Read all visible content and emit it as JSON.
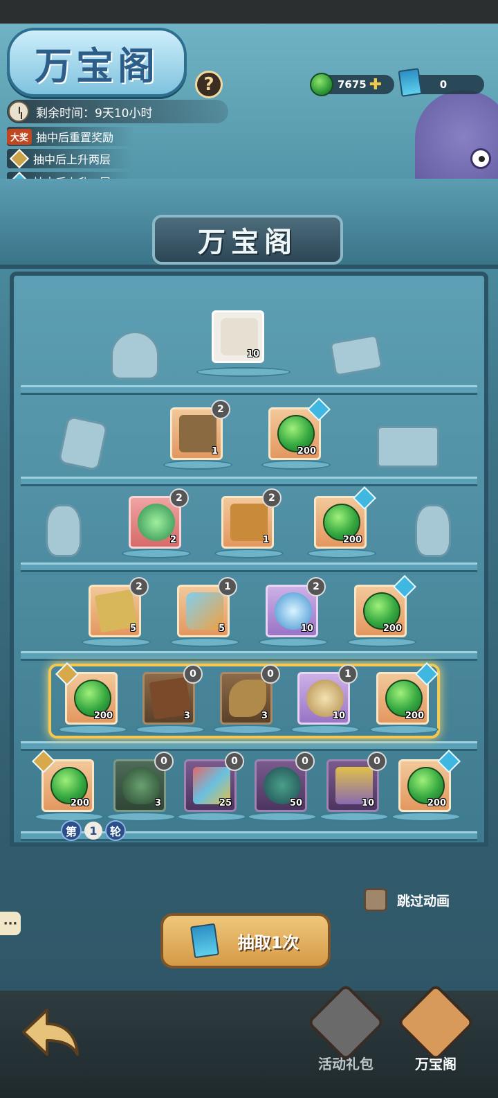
{
  "header": {
    "logo_text": "万宝阁",
    "help_label": "?",
    "timer": "剩余时间：9天10小时",
    "rules": [
      {
        "badge": "大奖",
        "text": "抽中后重置奖励"
      },
      {
        "text": "抽中后上升两层"
      },
      {
        "text": "抽中后上升一层"
      }
    ]
  },
  "currency": {
    "jade_amount": "7675",
    "ticket_amount": "0"
  },
  "pavilion": {
    "title": "万宝阁"
  },
  "rows": [
    [
      {
        "qty": "10",
        "count": null,
        "style": "grey",
        "upgrade": null
      }
    ],
    [
      {
        "qty": "1",
        "count": "2",
        "style": "orange",
        "upgrade": null
      },
      {
        "qty": "200",
        "count": null,
        "style": "orange",
        "upgrade": "cyan"
      }
    ],
    [
      {
        "qty": "2",
        "count": "2",
        "style": "red",
        "upgrade": null
      },
      {
        "qty": "1",
        "count": "2",
        "style": "orange",
        "upgrade": null
      },
      {
        "qty": "200",
        "count": null,
        "style": "orange",
        "upgrade": "cyan"
      }
    ],
    [
      {
        "qty": "5",
        "count": "2",
        "style": "orange",
        "upgrade": null
      },
      {
        "qty": "5",
        "count": "1",
        "style": "orange",
        "upgrade": null
      },
      {
        "qty": "10",
        "count": "2",
        "style": "purple",
        "upgrade": null
      },
      {
        "qty": "200",
        "count": null,
        "style": "orange",
        "upgrade": "cyan"
      }
    ],
    [
      {
        "qty": "200",
        "count": null,
        "style": "orange",
        "upgrade": "gold-left"
      },
      {
        "qty": "3",
        "count": "0",
        "style": "brown",
        "upgrade": null
      },
      {
        "qty": "3",
        "count": "0",
        "style": "brown",
        "upgrade": null
      },
      {
        "qty": "10",
        "count": "1",
        "style": "purple",
        "upgrade": null
      },
      {
        "qty": "200",
        "count": null,
        "style": "orange",
        "upgrade": "cyan"
      }
    ],
    [
      {
        "qty": "200",
        "count": null,
        "style": "orange",
        "upgrade": "gold-left"
      },
      {
        "qty": "3",
        "count": "0",
        "style": "dark",
        "upgrade": null
      },
      {
        "qty": "25",
        "count": "0",
        "style": "darkpurple",
        "upgrade": null
      },
      {
        "qty": "50",
        "count": "0",
        "style": "darkpurple",
        "upgrade": null
      },
      {
        "qty": "10",
        "count": "0",
        "style": "darkpurple",
        "upgrade": null
      },
      {
        "qty": "200",
        "count": null,
        "style": "orange",
        "upgrade": "cyan"
      }
    ]
  ],
  "round": {
    "prefix": "第",
    "number": "1",
    "suffix": "轮"
  },
  "skip_animation": "跳过动画",
  "draw_button": "抽取1次",
  "chat_label": "···",
  "tabs": [
    {
      "label": "活动礼包"
    },
    {
      "label": "万宝阁"
    }
  ],
  "colors": {
    "accent_gold": "#f4c953",
    "upgrade_cyan": "#3fb7e0",
    "upgrade_gold": "#d8a94a"
  }
}
